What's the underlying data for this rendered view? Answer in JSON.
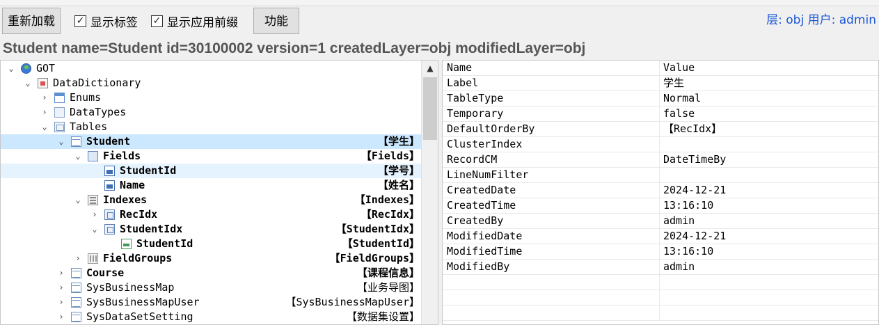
{
  "toolbar": {
    "reload_label": "重新加载",
    "show_labels": {
      "label": "显示标签",
      "checked": true
    },
    "show_prefix": {
      "label": "显示应用前缀",
      "checked": true
    },
    "function_label": "功能",
    "user_info": "层: obj 用户: admin"
  },
  "object_info": "Student name=Student id=30100002 version=1 createdLayer=obj modifiedLayer=obj",
  "tree": [
    {
      "name": "GOT",
      "label": "",
      "level": 0,
      "icon": "globe-icon",
      "expanded": true,
      "has_children": true
    },
    {
      "name": "DataDictionary",
      "label": "",
      "level": 1,
      "icon": "data-dictionary-icon",
      "expanded": true,
      "has_children": true
    },
    {
      "name": "Enums",
      "label": "",
      "level": 2,
      "icon": "enum-icon",
      "expanded": false,
      "has_children": true
    },
    {
      "name": "DataTypes",
      "label": "",
      "level": 2,
      "icon": "datatype-icon",
      "expanded": false,
      "has_children": true
    },
    {
      "name": "Tables",
      "label": "",
      "level": 2,
      "icon": "tables-icon",
      "expanded": true,
      "has_children": true
    },
    {
      "name": "Student",
      "label": "【学生】",
      "level": 3,
      "icon": "table-icon",
      "expanded": true,
      "has_children": true,
      "bold": true,
      "selected": true
    },
    {
      "name": "Fields",
      "label": "【Fields】",
      "level": 4,
      "icon": "fields-icon",
      "expanded": true,
      "has_children": true,
      "bold": true
    },
    {
      "name": "StudentId",
      "label": "【学号】",
      "level": 5,
      "icon": "field-icon",
      "has_children": false,
      "bold": true,
      "hover": true
    },
    {
      "name": "Name",
      "label": "【姓名】",
      "level": 5,
      "icon": "field-icon",
      "has_children": false,
      "bold": true
    },
    {
      "name": "Indexes",
      "label": "【Indexes】",
      "level": 4,
      "icon": "indexes-icon",
      "expanded": true,
      "has_children": true,
      "bold": true
    },
    {
      "name": "RecIdx",
      "label": "【RecIdx】",
      "level": 5,
      "icon": "index-icon",
      "expanded": false,
      "has_children": true,
      "bold": true
    },
    {
      "name": "StudentIdx",
      "label": "【StudentIdx】",
      "level": 5,
      "icon": "index-icon",
      "expanded": true,
      "has_children": true,
      "bold": true
    },
    {
      "name": "StudentId",
      "label": "【StudentId】",
      "level": 6,
      "icon": "index-field-icon",
      "has_children": false,
      "bold": true
    },
    {
      "name": "FieldGroups",
      "label": "【FieldGroups】",
      "level": 4,
      "icon": "field-groups-icon",
      "expanded": false,
      "has_children": true,
      "bold": true
    },
    {
      "name": "Course",
      "label": "【课程信息】",
      "level": 3,
      "icon": "table-icon",
      "expanded": false,
      "has_children": true,
      "bold": true
    },
    {
      "name": "SysBusinessMap",
      "label": "【业务导图】",
      "level": 3,
      "icon": "table-icon",
      "expanded": false,
      "has_children": true
    },
    {
      "name": "SysBusinessMapUser",
      "label": "【SysBusinessMapUser】",
      "level": 3,
      "icon": "table-icon",
      "expanded": false,
      "has_children": true
    },
    {
      "name": "SysDataSetSetting",
      "label": "【数据集设置】",
      "level": 3,
      "icon": "table-icon",
      "expanded": false,
      "has_children": true
    }
  ],
  "properties": {
    "header": {
      "name": "Name",
      "value": "Value"
    },
    "rows": [
      {
        "name": "Label",
        "value": "学生"
      },
      {
        "name": "TableType",
        "value": "Normal"
      },
      {
        "name": "Temporary",
        "value": "false"
      },
      {
        "name": "DefaultOrderBy",
        "value": "【RecIdx】"
      },
      {
        "name": "ClusterIndex",
        "value": ""
      },
      {
        "name": "RecordCM",
        "value": "DateTimeBy"
      },
      {
        "name": "LineNumFilter",
        "value": ""
      },
      {
        "name": "CreatedDate",
        "value": "2024-12-21"
      },
      {
        "name": "CreatedTime",
        "value": "13:16:10"
      },
      {
        "name": "CreatedBy",
        "value": "admin"
      },
      {
        "name": "ModifiedDate",
        "value": "2024-12-21"
      },
      {
        "name": "ModifiedTime",
        "value": "13:16:10"
      },
      {
        "name": "ModifiedBy",
        "value": "admin"
      },
      {
        "name": "",
        "value": ""
      },
      {
        "name": "",
        "value": ""
      },
      {
        "name": "",
        "value": ""
      }
    ]
  }
}
